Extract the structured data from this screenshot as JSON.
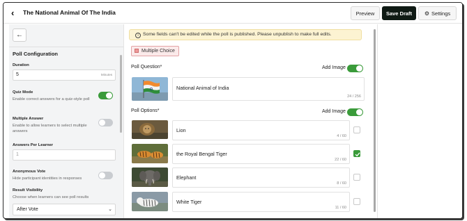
{
  "header": {
    "title": "The National Animal Of The India",
    "preview_label": "Preview",
    "save_label": "Save Draft",
    "settings_label": "Settings"
  },
  "sidebar": {
    "section_title": "Poll Configuration",
    "duration": {
      "label": "Duration",
      "value": "5",
      "unit": "Minutes"
    },
    "quiz_mode": {
      "label": "Quiz Mode",
      "help": "Enable correct answers for a quiz-style poll",
      "enabled": true
    },
    "multiple_answer": {
      "label": "Multiple Answer",
      "help": "Enable to allow learners to select multiple answers",
      "enabled": false
    },
    "answers_per_learner": {
      "label": "Answers Per Learner",
      "placeholder": "1"
    },
    "anonymous_vote": {
      "label": "Anonymous Vote",
      "help": "Hide participant identities in responses",
      "enabled": false
    },
    "result_visibility": {
      "label": "Result Visibility",
      "help": "Choose when learners can see poll results",
      "selected": "After Vote"
    }
  },
  "main": {
    "alert_text": "Some fields can't be edited while the poll is published. Please unpublish to make full edits.",
    "poll_type_badge": "Multiple Choice",
    "question": {
      "label": "Poll Question*",
      "add_image_label": "Add Image",
      "add_image_enabled": true,
      "text": "National Animal of India",
      "counter": "24 / 256"
    },
    "options": {
      "label": "Poll Options*",
      "add_image_label": "Add Image",
      "add_image_enabled": true,
      "items": [
        {
          "text": "Lion",
          "counter": "4 / 60",
          "correct": false
        },
        {
          "text": "the Royal Bengal Tiger",
          "counter": "22 / 60",
          "correct": true
        },
        {
          "text": "Elephant",
          "counter": "8 / 60",
          "correct": false
        },
        {
          "text": "White Tiger",
          "counter": "11 / 60",
          "correct": false
        }
      ]
    }
  },
  "colors": {
    "accent_green": "#3a9b3a",
    "save_button_bg": "#0f1a14",
    "alert_bg": "#fcf3d2",
    "badge_bg": "#fbeaea"
  }
}
